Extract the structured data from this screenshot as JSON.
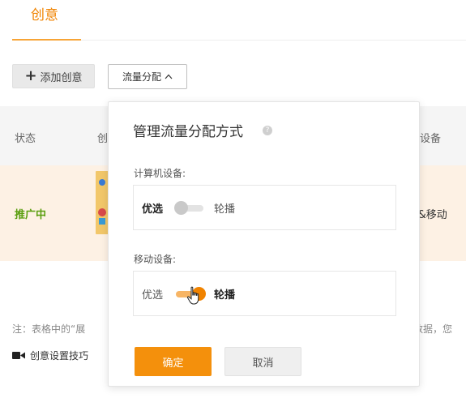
{
  "tabs": {
    "active_label": "创意"
  },
  "toolbar": {
    "add_icon": "plus-icon",
    "add_label": "添加创意",
    "traffic_label": "流量分配",
    "traffic_icon": "chevron-up-icon"
  },
  "table": {
    "headers": {
      "status": "状态",
      "creative_partial": "创",
      "device_partial": "设备"
    },
    "row": {
      "status": "推广中",
      "device_partial": "l&移动"
    }
  },
  "note": {
    "text": "注：表格中的“展",
    "right_partial": "数据，您"
  },
  "tips": {
    "icon": "video-camera-icon",
    "label": "创意设置技巧"
  },
  "popover": {
    "title": "管理流量分配方式",
    "help_icon": "question-circle-icon",
    "computer": {
      "label": "计算机设备:",
      "option_preferred": "优选",
      "option_rotate": "轮播",
      "switch_on": false
    },
    "mobile": {
      "label": "移动设备:",
      "option_preferred": "优选",
      "option_rotate": "轮播",
      "switch_on": true
    },
    "confirm_label": "确定",
    "cancel_label": "取消"
  },
  "colors": {
    "accent": "#f08300",
    "primary_button": "#f4900c",
    "row_highlight": "#fdf1e4",
    "status_green": "#5a9e0f",
    "switch_off_track": "#e3e3e3",
    "switch_off_knob": "#c9c9c9",
    "switch_on_track": "#f7b565",
    "switch_on_knob": "#f08300"
  }
}
